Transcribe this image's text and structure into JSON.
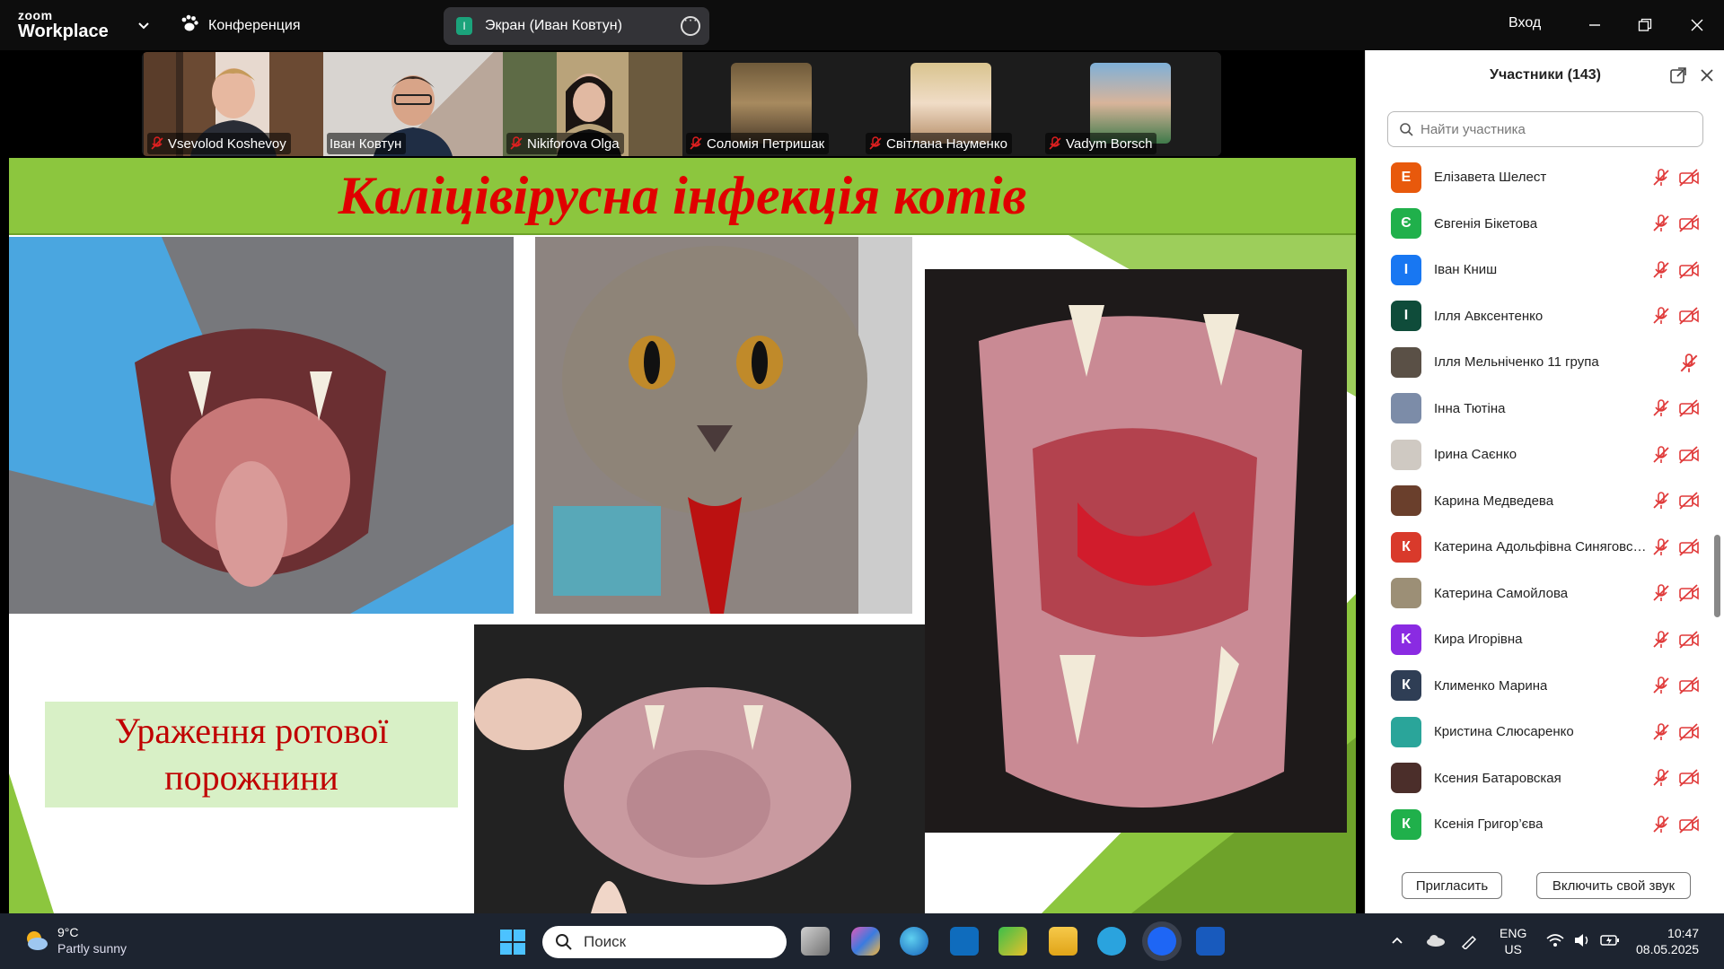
{
  "app": {
    "logo_top": "zoom",
    "logo_bottom": "Workplace",
    "meeting_label": "Конференция",
    "share_label": "Экран (Иван Ковтун)",
    "share_badge": "I",
    "signin": "Вход"
  },
  "video_tiles": [
    {
      "name": "Vsevolod Koshevoy",
      "muted": true
    },
    {
      "name": "Іван Ковтун",
      "muted": false,
      "active": true
    },
    {
      "name": "Nikiforova Olga",
      "muted": true
    },
    {
      "name": "Соломія Петришак",
      "muted": true
    },
    {
      "name": "Світлана Науменко",
      "muted": true
    },
    {
      "name": "Vadym Borsch",
      "muted": true
    }
  ],
  "slide": {
    "title": "Каліцівірусна інфекція котів",
    "caption_line1": "Ураження ротової",
    "caption_line2": "порожнини"
  },
  "participants": {
    "header": "Участники (143)",
    "search_placeholder": "Найти участника",
    "items": [
      {
        "name": "Елізавета Шелест",
        "initial": "Е",
        "color": "#e8590c",
        "mic_muted": true,
        "cam_off": true
      },
      {
        "name": "Євгенія Бікетова",
        "initial": "Є",
        "color": "#20b04b",
        "mic_muted": true,
        "cam_off": true
      },
      {
        "name": "Іван Книш",
        "initial": "І",
        "color": "#1877f2",
        "mic_muted": true,
        "cam_off": true
      },
      {
        "name": "Ілля Авксентенко",
        "initial": "І",
        "color": "#0f4c3a",
        "mic_muted": true,
        "cam_off": true
      },
      {
        "name": "Ілля Мельніченко 11 група",
        "initial": "",
        "color": "#5a5046",
        "mic_muted": true,
        "cam_off": false
      },
      {
        "name": "Інна Тютіна",
        "initial": "",
        "color": "#7c8ca8",
        "mic_muted": true,
        "cam_off": true
      },
      {
        "name": "Ірина Саєнко",
        "initial": "",
        "color": "#cfc9c2",
        "mic_muted": true,
        "cam_off": true
      },
      {
        "name": "Карина Медведева",
        "initial": "",
        "color": "#6a3f2c",
        "mic_muted": true,
        "cam_off": true
      },
      {
        "name": "Катерина Адольфівна Синяговська",
        "initial": "К",
        "color": "#d93a2b",
        "mic_muted": true,
        "cam_off": true
      },
      {
        "name": "Катерина Самойлова",
        "initial": "",
        "color": "#9c8f76",
        "mic_muted": true,
        "cam_off": true
      },
      {
        "name": "Кира Игорівна",
        "initial": "K",
        "color": "#8a2be2",
        "mic_muted": true,
        "cam_off": true
      },
      {
        "name": "Клименко Марина",
        "initial": "К",
        "color": "#2f3e55",
        "mic_muted": true,
        "cam_off": true
      },
      {
        "name": "Кристина Слюсаренко",
        "initial": "",
        "color": "#2aa59a",
        "mic_muted": true,
        "cam_off": true
      },
      {
        "name": "Ксения Батаровская",
        "initial": "",
        "color": "#4b2e2a",
        "mic_muted": true,
        "cam_off": true
      },
      {
        "name": "Ксенія Григор’єва",
        "initial": "К",
        "color": "#20b04b",
        "mic_muted": true,
        "cam_off": true
      }
    ],
    "invite_label": "Пригласить",
    "unmute_label": "Включить свой звук"
  },
  "taskbar": {
    "temperature": "9°C",
    "condition": "Partly sunny",
    "search_label": "Поиск",
    "lang_top": "ENG",
    "lang_bottom": "US",
    "time": "10:47",
    "date": "08.05.2025"
  }
}
